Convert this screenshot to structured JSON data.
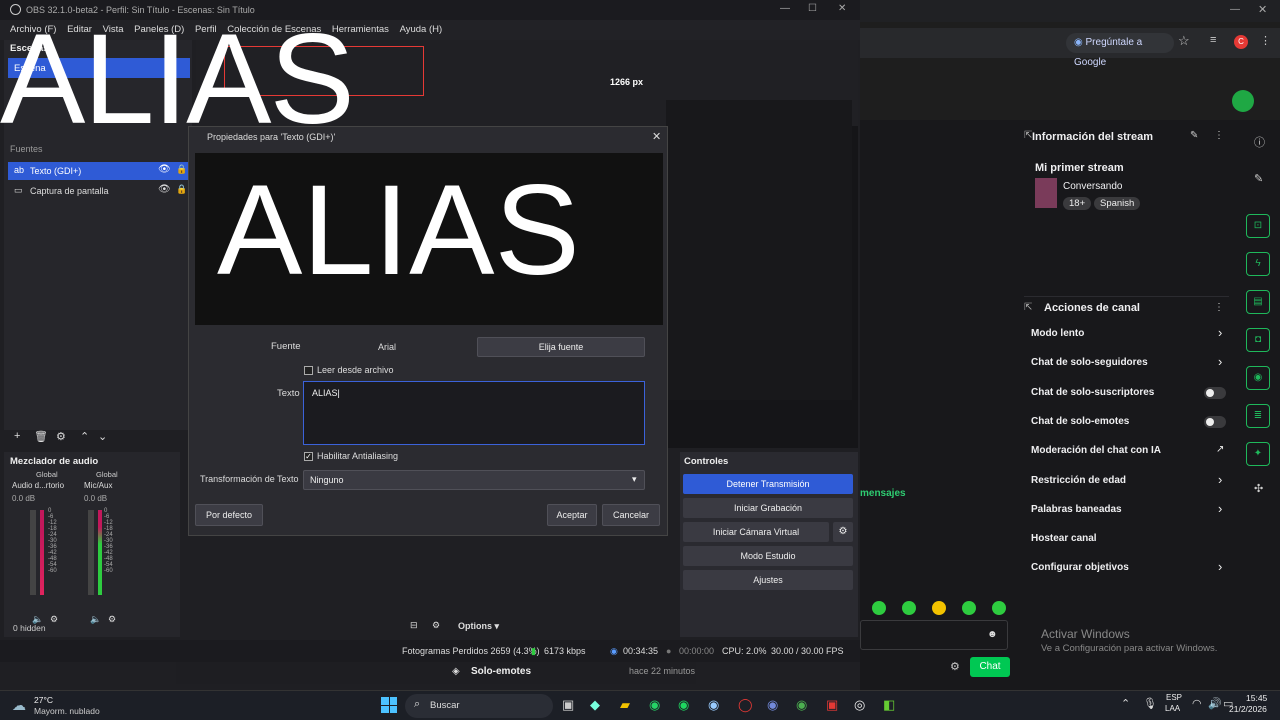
{
  "obs": {
    "title": "OBS 32.1.0-beta2 - Perfil: Sin Título - Escenas: Sin Título",
    "menu": [
      "Archivo (F)",
      "Editar",
      "Vista",
      "Paneles (D)",
      "Perfil",
      "Colección de Escenas",
      "Herramientas",
      "Ayuda (H)"
    ],
    "scenes_header": "Escenas",
    "scene_item": "Escena",
    "sources_header": "Fuentes",
    "sources": [
      "Texto (GDI+)",
      "Captura de pantalla"
    ],
    "resolution_badge": "1266 px",
    "mixer_header": "Mezclador de audio",
    "mixer_channels": [
      {
        "group": "Global",
        "name": "Audio d...rtorio",
        "db": "0.0 dB"
      },
      {
        "group": "Global",
        "name": "Mic/Aux",
        "db": "0.0 dB"
      }
    ],
    "meter_ticks": [
      "0",
      "-6",
      "-12",
      "-18",
      "-24",
      "-30",
      "-36",
      "-42",
      "-48",
      "-54",
      "-60"
    ],
    "hidden_count": "0 hidden",
    "options_label": "Options",
    "controls_header": "Controles",
    "controls": {
      "stop_stream": "Detener Transmisión",
      "start_recording": "Iniciar Grabación",
      "virtual_cam": "Iniciar Cámara Virtual",
      "studio_mode": "Modo Estudio",
      "settings": "Ajustes"
    },
    "status": {
      "dropped_frames": "Fotogramas Perdidos 2659 (4.3%)",
      "bitrate": "6173 kbps",
      "stream_time": "00:34:35",
      "rec_time": "00:00:00",
      "cpu": "CPU: 2.0%",
      "fps": "30.00 / 30.00 FPS"
    },
    "accent_blue": "#2f5bd6",
    "accent_red": "#e53935"
  },
  "overlay_text": "ALIAS",
  "dialog": {
    "title": "Propiedades para 'Texto (GDI+)'",
    "preview_text": "ALIAS",
    "font_label": "Fuente",
    "font_value": "Arial",
    "choose_font": "Elija fuente",
    "read_from_file": "Leer desde archivo",
    "text_label": "Texto",
    "text_value": "ALIAS",
    "antialias": "Habilitar Antialiasing",
    "transform_label": "Transformación de Texto",
    "transform_value": "Ninguno",
    "defaults": "Por defecto",
    "accept": "Aceptar",
    "cancel": "Cancelar"
  },
  "browser": {
    "ask_google": "Pregúntale a Google",
    "stream_info_title": "Información del stream",
    "stream_name": "Mi primer stream",
    "category": "Conversando",
    "tags": [
      "18+",
      "Spanish"
    ],
    "channel_actions_title": "Acciones de canal",
    "actions": [
      {
        "label": "Modo lento",
        "control": "chevron"
      },
      {
        "label": "Chat de solo-seguidores",
        "control": "chevron"
      },
      {
        "label": "Chat de solo-suscriptores",
        "control": "toggle"
      },
      {
        "label": "Chat de solo-emotes",
        "control": "toggle"
      },
      {
        "label": "Moderación del chat con IA",
        "control": "external"
      },
      {
        "label": "Restricción de edad",
        "control": "chevron"
      },
      {
        "label": "Palabras baneadas",
        "control": "chevron"
      },
      {
        "label": "Hostear canal",
        "control": "none"
      },
      {
        "label": "Configurar objetivos",
        "control": "chevron"
      }
    ],
    "mensajes": "mensajes",
    "solo_emotes": "Solo-emotes",
    "time_ago": "hace 22 minutos",
    "chat_button": "Chat",
    "activate_title": "Activar Windows",
    "activate_sub": "Ve a Configuración para activar Windows.",
    "twitch_green": "#00c853"
  },
  "taskbar": {
    "temp": "27°C",
    "weather": "Mayorm. nublado",
    "search": "Buscar",
    "lang": "ESP",
    "lang2": "LAA",
    "time": "15:45",
    "date": "21/2/2026"
  }
}
